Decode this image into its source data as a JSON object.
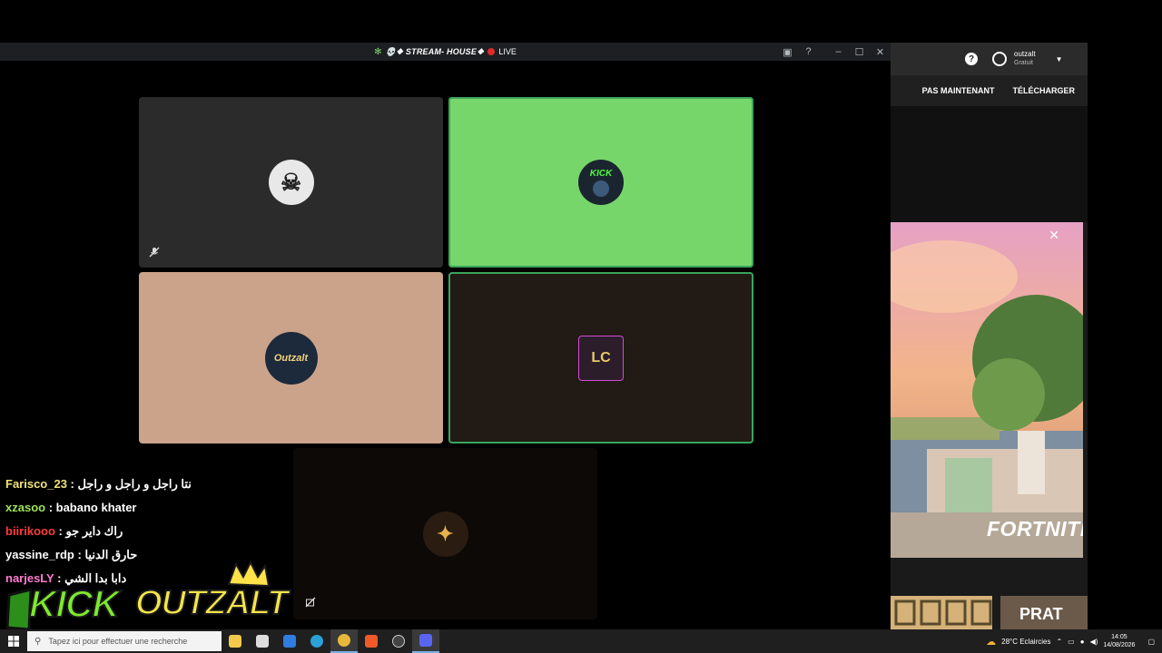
{
  "window": {
    "title": "💀❖ STREAM- HOUSE❖",
    "live_label": "LIVE"
  },
  "tiles": [
    {
      "name": "participant-1",
      "bg": "#2b2b2b",
      "avatar_bg": "#e8e8e8",
      "avatar_glyph": "☠",
      "speaking": false,
      "muted": true
    },
    {
      "name": "participant-2",
      "bg": "#77d66a",
      "avatar_bg": "#1b2530",
      "avatar_glyph": "KICK",
      "speaking": true,
      "muted": false
    },
    {
      "name": "participant-3",
      "bg": "#caa38a",
      "avatar_bg": "#1c2a3c",
      "avatar_glyph": "Outzalt",
      "speaking": false,
      "muted": false
    },
    {
      "name": "participant-4",
      "bg": "#221a14",
      "avatar_bg": "#2b1d2a",
      "avatar_glyph": "LC",
      "speaking": true,
      "muted": false
    },
    {
      "name": "participant-5",
      "bg": "#0c0907",
      "avatar_bg": "#2a1c10",
      "avatar_glyph": "✦",
      "speaking": false,
      "muted": true
    }
  ],
  "side": {
    "username": "outzalt",
    "plan": "Gratuit",
    "not_now": "PAS MAINTENANT",
    "download": "TÉLÉCHARGER",
    "ad_brand": "FORTNITE",
    "thumb_text": "PRAT"
  },
  "chat": [
    {
      "user": "Farisco_23",
      "color": "#f0e27a",
      "msg": "نتا راجل و راجل و راجل"
    },
    {
      "user": "xzasoo",
      "color": "#9be35a",
      "msg": "babano khater"
    },
    {
      "user": "biirikooo",
      "color": "#ff3b3b",
      "msg": "راك داير جو"
    },
    {
      "user": "yassine_rdp",
      "color": "#ffffff",
      "msg": "حارق الدنيا"
    },
    {
      "user": "narjesLY",
      "color": "#ff7ad0",
      "msg": "دابا بدا الشي"
    }
  ],
  "overlay": {
    "kick_text": "KICK",
    "outzalt_text": "OUTZALT"
  },
  "taskbar": {
    "search_placeholder": "Tapez ici pour effectuer une recherche",
    "weather": "28°C  Eclaircies",
    "time": "14:05",
    "date": "14/08/2026"
  }
}
